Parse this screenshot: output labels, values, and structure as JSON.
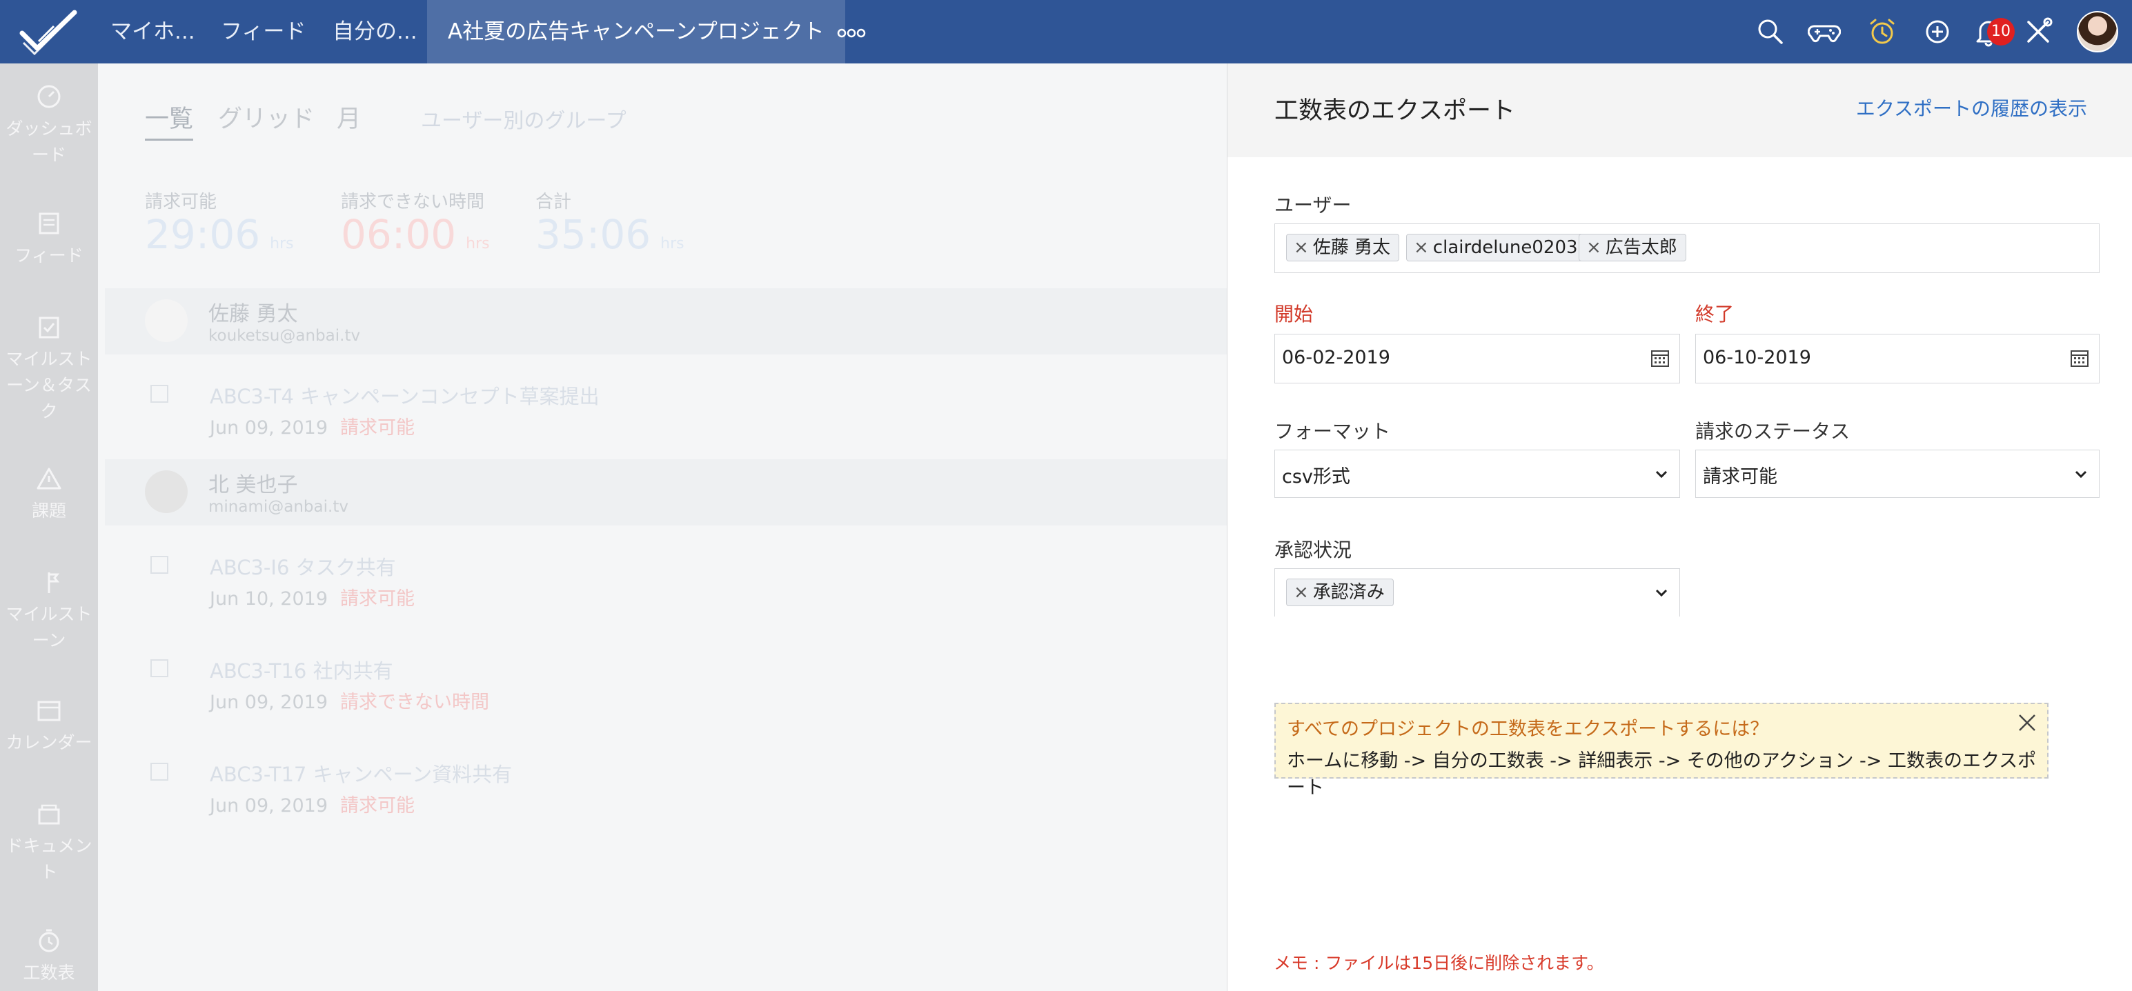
{
  "topbar": {
    "nav": [
      "マイホ...",
      "フィード",
      "自分の...",
      "A社夏の広告キャンペーンプロジェクト"
    ],
    "more_icon": "more-dots-icon",
    "icons": [
      "search-icon",
      "gamepad-icon",
      "timer-icon",
      "add-icon",
      "bell-icon",
      "tools-icon"
    ],
    "notification_count": "10",
    "accent": "#2f5596"
  },
  "sidebar": {
    "items": [
      {
        "label": "ダッシュボ\nード",
        "icon": "dashboard-icon"
      },
      {
        "label": "フィード",
        "icon": "feed-icon"
      },
      {
        "label": "マイルスト\nーン＆タス\nク",
        "icon": "tasks-icon"
      },
      {
        "label": "課題",
        "icon": "issue-icon"
      },
      {
        "label": "マイルスト\nーン",
        "icon": "milestone-icon"
      },
      {
        "label": "カレンダー",
        "icon": "calendar-icon"
      },
      {
        "label": "ドキュメン\nト",
        "icon": "document-icon"
      },
      {
        "label": "工数表",
        "icon": "timesheet-icon"
      }
    ]
  },
  "background": {
    "tabs": [
      "一覧",
      "グリッド",
      "月",
      "ユーザー別のグループ"
    ],
    "summary": [
      {
        "label": "請求可能",
        "value": "29:06",
        "unit": "hrs"
      },
      {
        "label": "請求できない時間",
        "value": "06:00",
        "unit": "hrs"
      },
      {
        "label": "合計",
        "value": "35:06",
        "unit": "hrs"
      }
    ],
    "users": [
      {
        "name": "佐藤 勇太",
        "email": "kouketsu@anbai.tv"
      },
      {
        "name": "北 美也子",
        "email": "minami@anbai.tv"
      }
    ],
    "tasks": [
      {
        "id": "ABC3-T4",
        "title": "キャンペーンコンセプト草案提出",
        "date": "Jun 09, 2019",
        "status": "請求可能"
      },
      {
        "id": "ABC3-I6",
        "title": "タスク共有",
        "date": "Jun 10, 2019",
        "status": "請求可能"
      },
      {
        "id": "ABC3-T16",
        "title": "社内共有",
        "date": "Jun 09, 2019",
        "status": "請求できない時間"
      },
      {
        "id": "ABC3-T17",
        "title": "キャンペーン資料共有",
        "date": "Jun 09, 2019",
        "status": "請求可能"
      }
    ]
  },
  "panel": {
    "title": "工数表のエクスポート",
    "history_link": "エクスポートの履歴の表示",
    "users_label": "ユーザー",
    "users": [
      "佐藤 勇太",
      "clairdelune0203",
      "広告太郎"
    ],
    "start_label": "開始",
    "start_value": "06-02-2019",
    "end_label": "終了",
    "end_value": "06-10-2019",
    "format_label": "フォーマット",
    "format_value": "csv形式",
    "billing_label": "請求のステータス",
    "billing_value": "請求可能",
    "approval_label": "承認状況",
    "approval_chip": "承認済み",
    "tip_title": "すべてのプロジェクトの工数表をエクスポートするには？",
    "tip_body": "ホームに移動 -> 自分の工数表 -> 詳細表示 -> その他のアクション -> 工数表のエクスポート",
    "memo": "メモ : ファイルは15日後に削除されます。"
  }
}
